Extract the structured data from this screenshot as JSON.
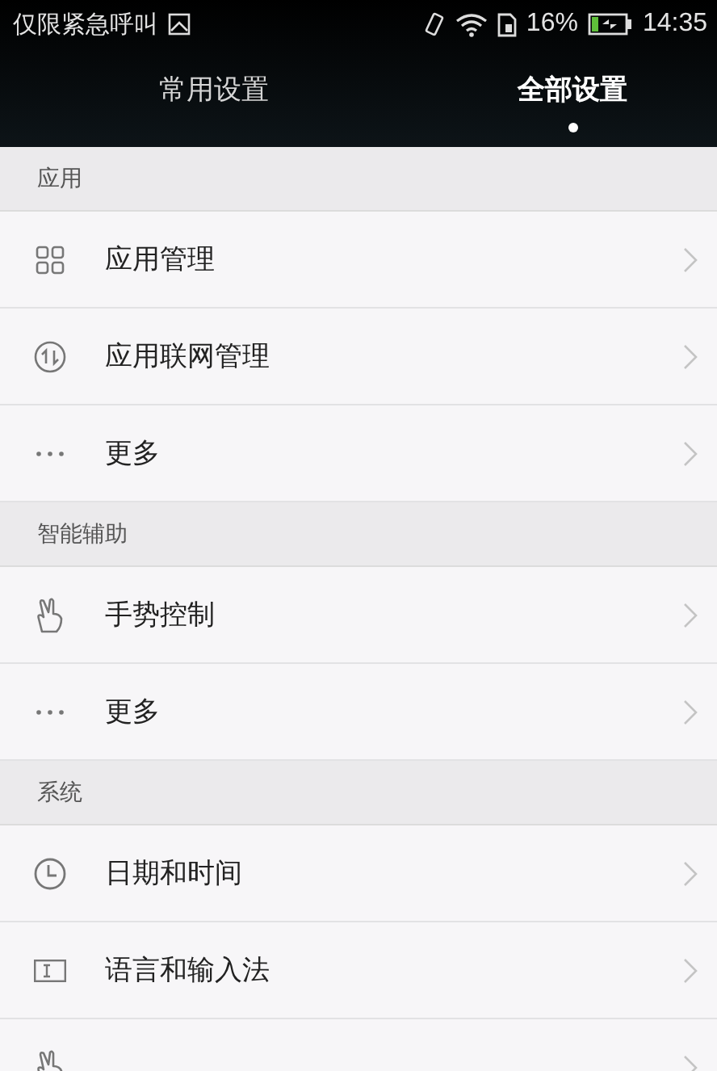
{
  "status_bar": {
    "carrier": "仅限紧急呼叫",
    "battery_percent": "16%",
    "time": "14:35"
  },
  "tabs": [
    {
      "label": "常用设置",
      "selected": false
    },
    {
      "label": "全部设置",
      "selected": true
    }
  ],
  "sections": [
    {
      "title": "应用",
      "items": [
        {
          "label": "应用管理",
          "kind": "grid"
        },
        {
          "label": "应用联网管理",
          "kind": "network"
        },
        {
          "label": "更多",
          "kind": "dots"
        }
      ]
    },
    {
      "title": "智能辅助",
      "items": [
        {
          "label": "手势控制",
          "kind": "gesture"
        },
        {
          "label": "更多",
          "kind": "dots"
        }
      ]
    },
    {
      "title": "系统",
      "items": [
        {
          "label": "日期和时间",
          "kind": "clock"
        },
        {
          "label": "语言和输入法",
          "kind": "input"
        },
        {
          "kind": "hand"
        }
      ]
    }
  ]
}
